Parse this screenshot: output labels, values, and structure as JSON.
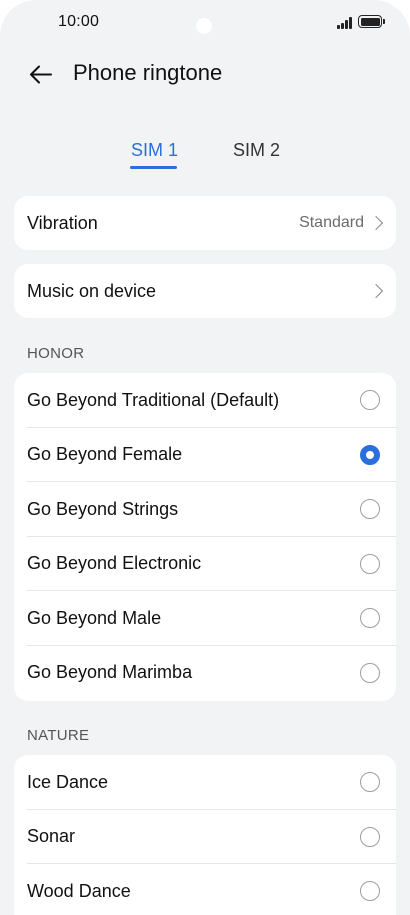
{
  "status_bar": {
    "time": "10:00"
  },
  "header": {
    "title": "Phone ringtone"
  },
  "tabs": [
    {
      "label": "SIM 1",
      "active": true
    },
    {
      "label": "SIM 2",
      "active": false
    }
  ],
  "vibration": {
    "label": "Vibration",
    "value": "Standard"
  },
  "music_on_device": {
    "label": "Music on device"
  },
  "sections": [
    {
      "title": "HONOR",
      "items": [
        {
          "label": "Go Beyond Traditional (Default)",
          "selected": false
        },
        {
          "label": "Go Beyond Female",
          "selected": true
        },
        {
          "label": "Go Beyond Strings",
          "selected": false
        },
        {
          "label": "Go Beyond Electronic",
          "selected": false
        },
        {
          "label": "Go Beyond Male",
          "selected": false
        },
        {
          "label": "Go Beyond Marimba",
          "selected": false
        }
      ]
    },
    {
      "title": "NATURE",
      "items": [
        {
          "label": "Ice Dance",
          "selected": false
        },
        {
          "label": "Sonar",
          "selected": false
        },
        {
          "label": "Wood Dance",
          "selected": false
        }
      ]
    }
  ],
  "colors": {
    "accent": "#2a6fdb",
    "background": "#f1f3f5",
    "card": "#ffffff"
  },
  "icons": {
    "back": "arrow-left-icon",
    "chevron": "chevron-right-icon",
    "radio": "radio-button-icon",
    "signal": "signal-icon",
    "battery": "battery-icon"
  }
}
